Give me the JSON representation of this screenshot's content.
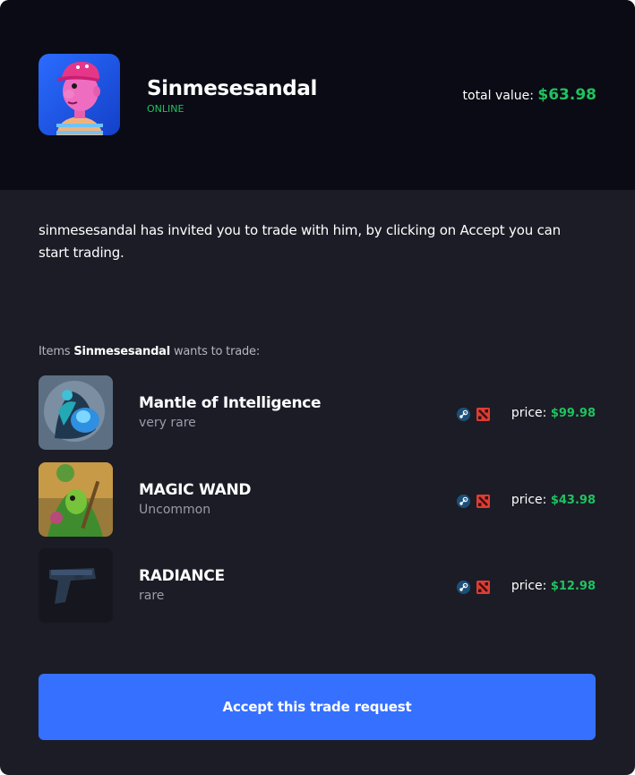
{
  "profile": {
    "username": "Sinmesesandal",
    "status": "ONLINE",
    "total_value_label": "total value:",
    "total_value": "$63.98",
    "avatar_icon": "cartoon-avatar-icon"
  },
  "invite": {
    "message": "sinmesesandal has invited you to trade with him,  by clicking on Accept you can start trading."
  },
  "items_section": {
    "prefix": "Items",
    "user": "Sinmesesandal",
    "suffix": "wants to trade:"
  },
  "items": [
    {
      "name": "Mantle of Intelligence",
      "rarity": "very rare",
      "price_label": "price:",
      "price": "$99.98",
      "platform_icons": [
        "steam-icon",
        "dota-icon"
      ]
    },
    {
      "name": "MAGIC WAND",
      "rarity": "Uncommon",
      "price_label": "price:",
      "price": "$43.98",
      "platform_icons": [
        "steam-icon",
        "dota-icon"
      ]
    },
    {
      "name": "RADIANCE",
      "rarity": "rare",
      "price_label": "price:",
      "price": "$12.98",
      "platform_icons": [
        "steam-icon",
        "dota-icon"
      ]
    }
  ],
  "accept_button": {
    "label": "Accept this trade request"
  },
  "colors": {
    "background": "#1b1c26",
    "header": "#0a0b14",
    "accent_green": "#1fc25f",
    "button_blue": "#3670ff"
  }
}
